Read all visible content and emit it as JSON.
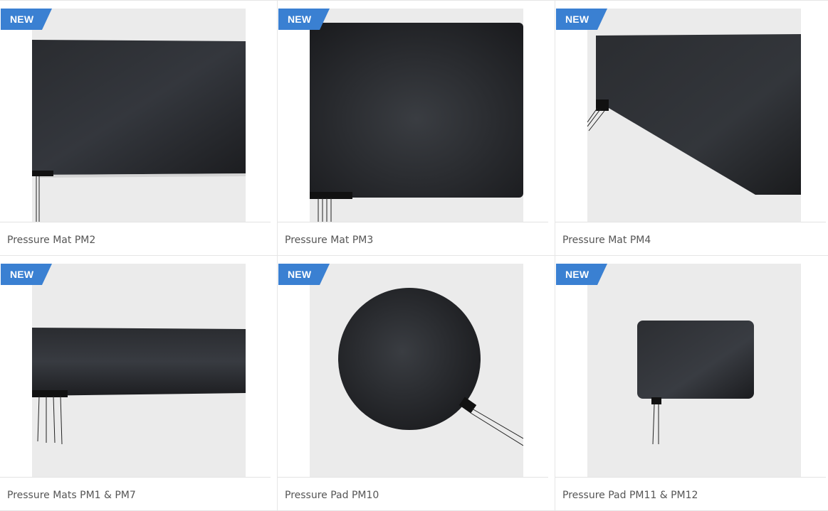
{
  "badge_color": "#3a80d2",
  "products": [
    {
      "badge": "NEW",
      "title": "Pressure Mat PM2",
      "image_icon": "pressure-mat-pm2"
    },
    {
      "badge": "NEW",
      "title": "Pressure Mat PM3",
      "image_icon": "pressure-mat-pm3"
    },
    {
      "badge": "NEW",
      "title": "Pressure Mat PM4",
      "image_icon": "pressure-mat-pm4"
    },
    {
      "badge": "NEW",
      "title": "Pressure Mats PM1 & PM7",
      "image_icon": "pressure-mats-pm1-pm7"
    },
    {
      "badge": "NEW",
      "title": "Pressure Pad PM10",
      "image_icon": "pressure-pad-pm10"
    },
    {
      "badge": "NEW",
      "title": "Pressure Pad PM11 & PM12",
      "image_icon": "pressure-pad-pm11-pm12"
    }
  ]
}
